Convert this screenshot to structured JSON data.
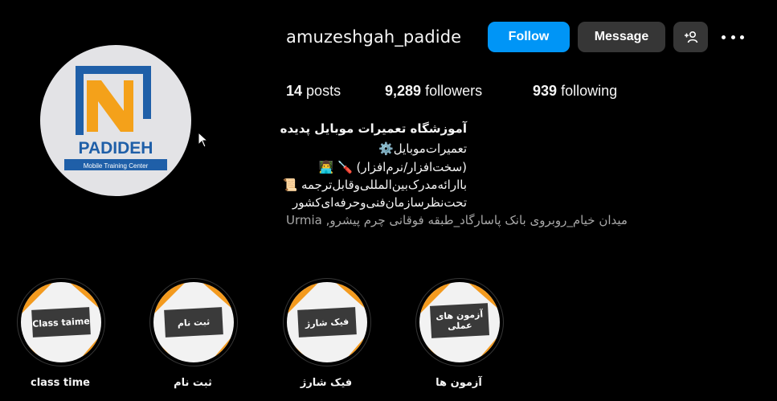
{
  "profile": {
    "username": "amuzeshgah_padide",
    "avatar_text": "PADIDEH",
    "avatar_subtext": "Mobile Training Center"
  },
  "actions": {
    "follow_label": "Follow",
    "message_label": "Message",
    "suggest_icon": "person-plus-icon",
    "more_icon": "more-horizontal-icon"
  },
  "stats": {
    "posts_count": "14",
    "posts_label": "posts",
    "followers_count": "9,289",
    "followers_label": "followers",
    "following_count": "939",
    "following_label": "following"
  },
  "bio": {
    "name": "آموزشگاه تعمیرات موبایل پدیده",
    "line1": "تعمیرات‌موبایل⚙️",
    "line2": "(سخت‌افزار/نرم‌افزار) 🪛 👨‍💻",
    "line3": "باارائه‌مدرک‌بین‌المللی‌وقابل‌ترجمه 📜",
    "line4": "تحت‌نظرسازمان‌فنی‌وحرفه‌ای‌کشور",
    "address": "Urmia ,میدان خیام_روبروی بانک پاسارگاد_طبقه فوقانی چرم پیشرو"
  },
  "highlights": [
    {
      "card_text": "Class taime",
      "label": "class time"
    },
    {
      "card_text": "ثبت نام",
      "label": "ثبت نام"
    },
    {
      "card_text": "فیک شارژ",
      "label": "فیک شارژ"
    },
    {
      "card_text": "آزمون های عملی",
      "label": "آزمون ها"
    }
  ],
  "colors": {
    "background": "#000000",
    "follow_button": "#0095f6",
    "secondary_button": "#363636",
    "text_primary": "#f5f5f5",
    "text_secondary": "#a8a8a8",
    "logo_blue": "#1f5fa8",
    "logo_orange": "#f4a11a"
  }
}
